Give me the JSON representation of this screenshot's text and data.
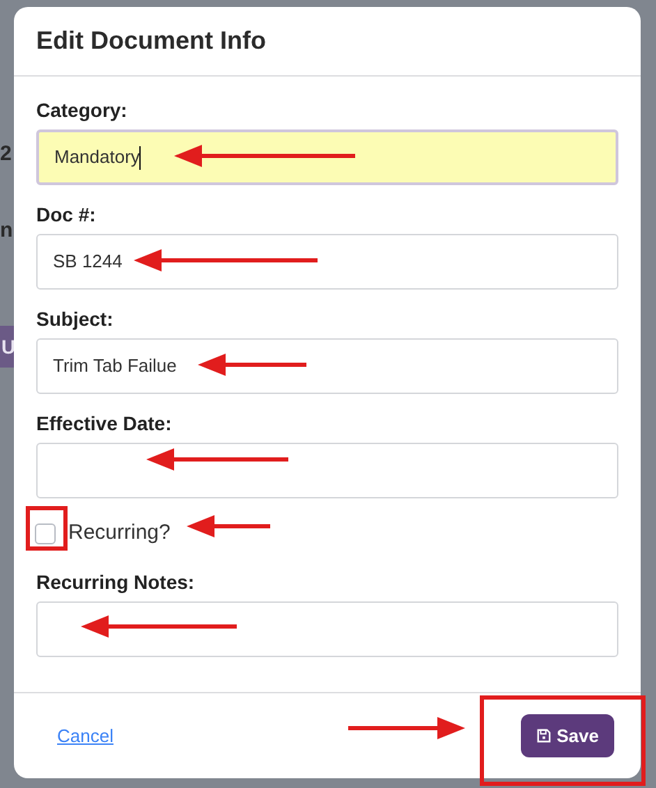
{
  "background": {
    "fragments": [
      {
        "kind": "text",
        "text": "2"
      },
      {
        "kind": "text",
        "text": "n"
      },
      {
        "kind": "button",
        "text": "U"
      }
    ]
  },
  "dialog": {
    "title": "Edit Document Info",
    "fields": [
      {
        "kind": "text",
        "label": "Category:",
        "value": "Mandatory",
        "focused": true
      },
      {
        "kind": "text",
        "label": "Doc #:",
        "value": "SB 1244",
        "focused": false
      },
      {
        "kind": "text",
        "label": "Subject:",
        "value": "Trim Tab Failue",
        "focused": false
      },
      {
        "kind": "text",
        "label": "Effective Date:",
        "focused": false
      },
      {
        "kind": "checkbox",
        "label": "Recurring?",
        "checked": false
      },
      {
        "kind": "text",
        "label": "Recurring Notes:",
        "focused": false
      }
    ],
    "cancel": "Cancel",
    "save": "Save"
  }
}
